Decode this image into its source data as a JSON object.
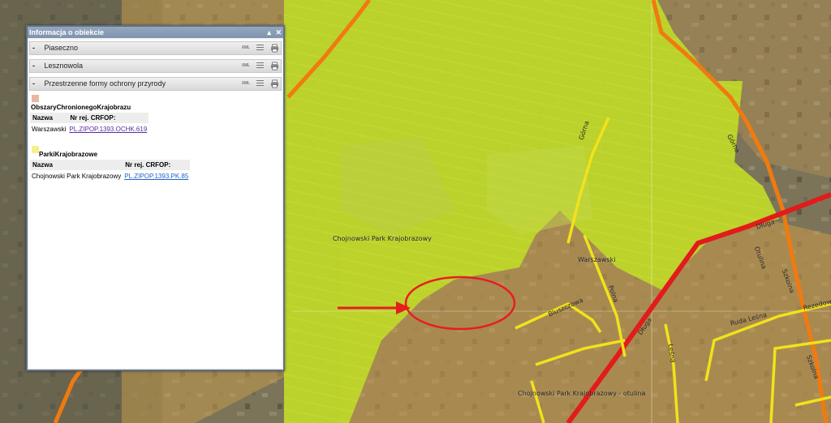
{
  "panel": {
    "title": "Informacja o obiekcie",
    "controls": {
      "minimize": "▴",
      "close": "✕"
    },
    "sections": [
      {
        "toggle": "-",
        "title": "Piaseczno",
        "xml": "XML"
      },
      {
        "toggle": "-",
        "title": "Lesznowola",
        "xml": "XML"
      },
      {
        "toggle": "-",
        "title": "Przestrzenne formy ochrony przyrody",
        "xml": "XML"
      }
    ],
    "layers": [
      {
        "title": "ObszaryChronionegoKrajobrazu",
        "swatch_color": "#e8b7a4",
        "columns": [
          "Nazwa",
          "Nr rej. CRFOP:"
        ],
        "rows": [
          {
            "name": "Warszawski",
            "link": "PL.ZIPOP.1393.OCHK.619"
          }
        ]
      },
      {
        "title": "ParkiKrajobrazowe",
        "swatch_color": "#f3f28a",
        "columns": [
          "Nazwa",
          "Nr rej. CRFOP:"
        ],
        "rows": [
          {
            "name": "Chojnowski Park Krajobrazowy",
            "link": "PL.ZIPOP.1393.PK.85"
          }
        ]
      }
    ]
  },
  "map": {
    "labels": {
      "park": "Chojnowski Park Krajobrazowy",
      "warszawski": "Warszawski",
      "otulina": "Chojnowski Park Krajobrazowy - otulina"
    },
    "streets": {
      "gorna": "Górna",
      "gorna2": "Górna",
      "dluga": "Długa",
      "dluga2": "Długa",
      "ruda": "Ruda Leśna",
      "polna": "Polna",
      "leca": "Leśna",
      "bluszczowa": "Bluszczowa",
      "szkolna": "Szkolna",
      "szkolna2": "Szkolna",
      "otulina_st": "Otulina",
      "rezedowa": "Rezedowa"
    },
    "colors": {
      "park_fill": "#d9ea2a",
      "buffer_fill": "#c69a4c",
      "main_road": "#e21b1b",
      "secondary_road": "#f07a10",
      "local_road": "#f2e21a",
      "annotation": "#e61e1e"
    }
  }
}
